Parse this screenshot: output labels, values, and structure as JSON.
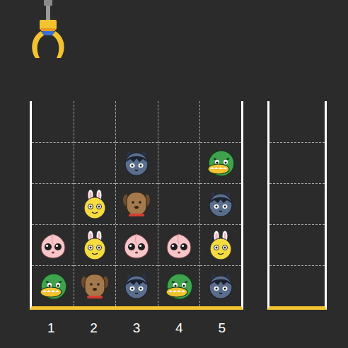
{
  "board": {
    "rows": 5,
    "columns": [
      {
        "label": "1",
        "items": [
          {
            "kind": "tube"
          },
          {
            "kind": "apeach"
          }
        ]
      },
      {
        "label": "2",
        "items": [
          {
            "kind": "frodo"
          },
          {
            "kind": "muzi"
          },
          {
            "kind": "muzi"
          }
        ]
      },
      {
        "label": "3",
        "items": [
          {
            "kind": "neo"
          },
          {
            "kind": "apeach"
          },
          {
            "kind": "frodo"
          },
          {
            "kind": "neo"
          }
        ]
      },
      {
        "label": "4",
        "items": [
          {
            "kind": "tube"
          },
          {
            "kind": "apeach"
          }
        ]
      },
      {
        "label": "5",
        "items": [
          {
            "kind": "neo"
          },
          {
            "kind": "muzi"
          },
          {
            "kind": "neo"
          },
          {
            "kind": "tube"
          }
        ]
      }
    ]
  },
  "side_bin": {
    "items": []
  },
  "claw": {
    "holding": false
  }
}
